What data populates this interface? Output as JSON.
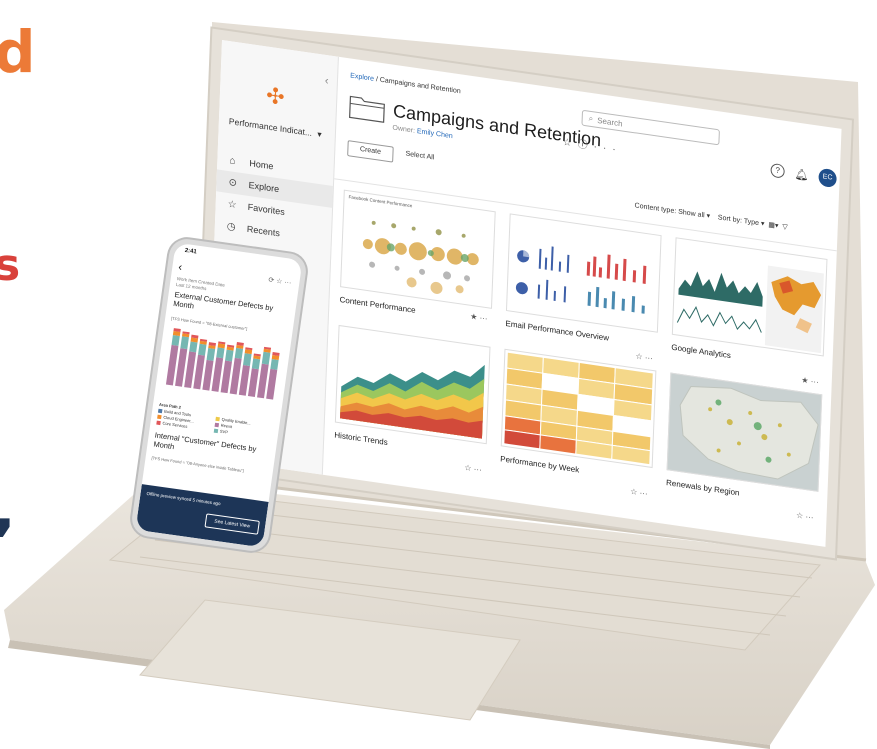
{
  "edge_text": {
    "frag1": "d",
    "frag2": "s",
    "frag3": ","
  },
  "laptop": {
    "sidebar": {
      "site_name": "Performance Indicat...",
      "items": [
        {
          "label": "Home",
          "icon": "home-icon"
        },
        {
          "label": "Explore",
          "icon": "compass-icon",
          "active": true
        },
        {
          "label": "Favorites",
          "icon": "star-icon"
        },
        {
          "label": "Recents",
          "icon": "clock-icon"
        }
      ]
    },
    "breadcrumb": {
      "root": "Explore",
      "separator": "/",
      "current": "Campaigns and Retention"
    },
    "title": "Campaigns and Retention",
    "owner_label": "Owner:",
    "owner_name": "Emily Chen",
    "search_placeholder": "Search",
    "avatar_initials": "EC",
    "create_label": "Create",
    "select_all_label": "Select All",
    "content_type_label": "Content type:",
    "content_type_value": "Show all",
    "sort_label": "Sort by:",
    "sort_value": "Type",
    "cards": [
      {
        "name": "Content Performance",
        "thumb_title": "Facebook Content Performance",
        "favorite": true
      },
      {
        "name": "Email Performance Overview",
        "thumb_title": "",
        "favorite": false
      },
      {
        "name": "Google Analytics",
        "thumb_title": "",
        "favorite": true
      },
      {
        "name": "Historic Trends",
        "thumb_title": "",
        "favorite": false
      },
      {
        "name": "Performance by Week",
        "thumb_title": "",
        "favorite": false
      },
      {
        "name": "Renewals by Region",
        "thumb_title": "",
        "favorite": false
      }
    ],
    "colors": {
      "accent": "#1f66b8",
      "avatar": "#1f4f8b",
      "logo": "#e97627"
    }
  },
  "phone": {
    "time": "2:41",
    "filter_label": "Work Item Created Date",
    "filter_value": "Last 12 months",
    "chart1_title": "External Customer Defects by Month",
    "chart1_sub": "[TFS How Found = \"08-External customer\"]",
    "legend_title": "Area Path 2",
    "legend": [
      {
        "label": "Build and Tools",
        "color": "#4e79a7"
      },
      {
        "label": "Quality Enable...",
        "color": "#edc948"
      },
      {
        "label": "Cloud Engineer...",
        "color": "#f28e2b"
      },
      {
        "label": "Reexit",
        "color": "#b07aa1"
      },
      {
        "label": "Core Services",
        "color": "#e15759"
      },
      {
        "label": "SVP",
        "color": "#76b7b2"
      }
    ],
    "chart2_title": "Internal \"Customer\" Defects by Month",
    "chart2_sub": "[TFS How Found = \"08-Anyone else inside Tableau\"]",
    "footer_text": "Offline preview synced 5 minutes ago",
    "footer_button": "See Latest View"
  }
}
